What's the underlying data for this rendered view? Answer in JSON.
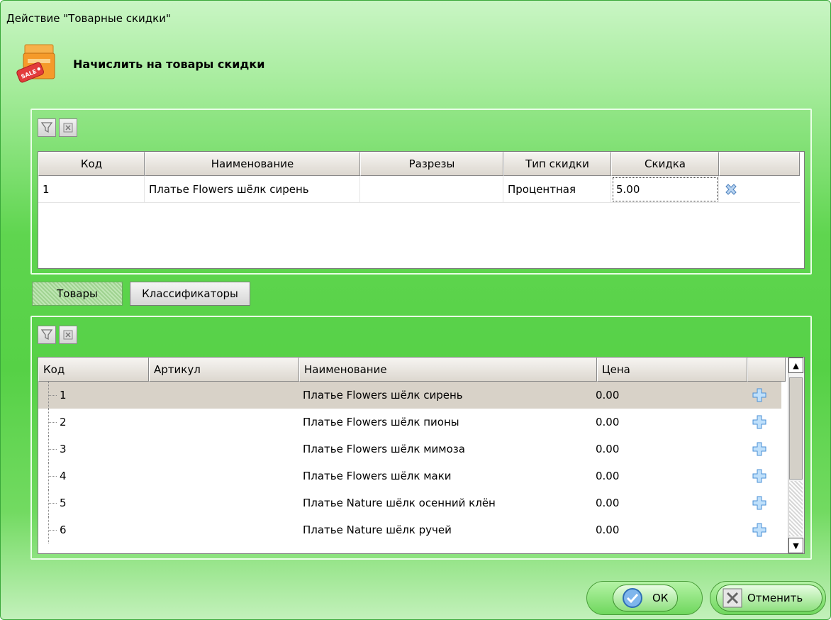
{
  "window": {
    "title": "Действие \"Товарные скидки\""
  },
  "header": {
    "heading": "Начислить на товары скидки",
    "icon": "sale-box-icon"
  },
  "discounts_grid": {
    "columns": [
      "Код",
      "Наименование",
      "Разрезы",
      "Тип скидки",
      "Скидка"
    ],
    "rows": [
      {
        "code": "1",
        "name": "Платье Flowers шёлк сирень",
        "cuts": "",
        "type": "Процентная",
        "discount": "5.00"
      }
    ]
  },
  "tabs": {
    "goods": "Товары",
    "classifiers": "Классификаторы"
  },
  "goods_grid": {
    "columns": [
      "Код",
      "Артикул",
      "Наименование",
      "Цена"
    ],
    "rows": [
      {
        "code": "1",
        "article": "",
        "name": "Платье Flowers шёлк сирень",
        "price": "0.00"
      },
      {
        "code": "2",
        "article": "",
        "name": "Платье Flowers шёлк пионы",
        "price": "0.00"
      },
      {
        "code": "3",
        "article": "",
        "name": "Платье Flowers шёлк мимоза",
        "price": "0.00"
      },
      {
        "code": "4",
        "article": "",
        "name": "Платье Flowers шёлк маки",
        "price": "0.00"
      },
      {
        "code": "5",
        "article": "",
        "name": "Платье Nature шёлк осенний клён",
        "price": "0.00"
      },
      {
        "code": "6",
        "article": "",
        "name": "Платье Nature шёлк ручей",
        "price": "0.00"
      }
    ]
  },
  "buttons": {
    "ok": "ОК",
    "cancel": "Отменить"
  },
  "colors": {
    "accent": "#5fd54f",
    "plus": "#4a8fd6",
    "remove": "#6aa0d8"
  }
}
